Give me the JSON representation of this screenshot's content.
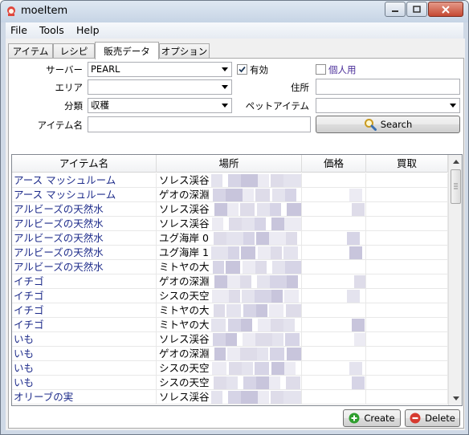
{
  "window": {
    "title": "moeItem"
  },
  "menu": [
    "File",
    "Tools",
    "Help"
  ],
  "tabs": [
    "アイテム",
    "レシピ",
    "販売データ",
    "オプション"
  ],
  "form": {
    "server_label": "サーバー",
    "server_value": "PEARL",
    "enabled_label": "有効",
    "enabled_checked": true,
    "personal_label": "個人用",
    "personal_checked": false,
    "area_label": "エリア",
    "area_value": "",
    "address_label": "住所",
    "address_value": "",
    "category_label": "分類",
    "category_value": "収穫",
    "pet_item_label": "ペットアイテム",
    "pet_item_value": "",
    "item_name_label": "アイテム名",
    "item_name_value": "",
    "search_label": "Search"
  },
  "grid": {
    "columns": [
      "アイテム名",
      "場所",
      "価格",
      "買取"
    ],
    "rows": [
      {
        "name": "アース マッシュルーム",
        "place": "ソレス渓谷"
      },
      {
        "name": "アース マッシュルーム",
        "place": "ゲオの深淵"
      },
      {
        "name": "アルビーズの天然水",
        "place": "ソレス渓谷"
      },
      {
        "name": "アルビーズの天然水",
        "place": "ソレス渓谷"
      },
      {
        "name": "アルビーズの天然水",
        "place": "ユグ海岸 0"
      },
      {
        "name": "アルビーズの天然水",
        "place": "ユグ海岸 1"
      },
      {
        "name": "アルビーズの天然水",
        "place": "ミトヤの大"
      },
      {
        "name": "イチゴ",
        "place": "ゲオの深淵"
      },
      {
        "name": "イチゴ",
        "place": "シスの天空"
      },
      {
        "name": "イチゴ",
        "place": "ミトヤの大"
      },
      {
        "name": "イチゴ",
        "place": "ミトヤの大"
      },
      {
        "name": "いも",
        "place": "ソレス渓谷"
      },
      {
        "name": "いも",
        "place": "ゲオの深淵"
      },
      {
        "name": "いも",
        "place": "シスの天空"
      },
      {
        "name": "いも",
        "place": "シスの天空"
      },
      {
        "name": "オリーブの実",
        "place": "ソレス渓谷"
      }
    ]
  },
  "buttons": {
    "create": "Create",
    "delete": "Delete"
  },
  "colors": {
    "link_text": "#1d2b8a",
    "create_icon": "#2e9e2e",
    "delete_icon": "#d63a2f"
  }
}
